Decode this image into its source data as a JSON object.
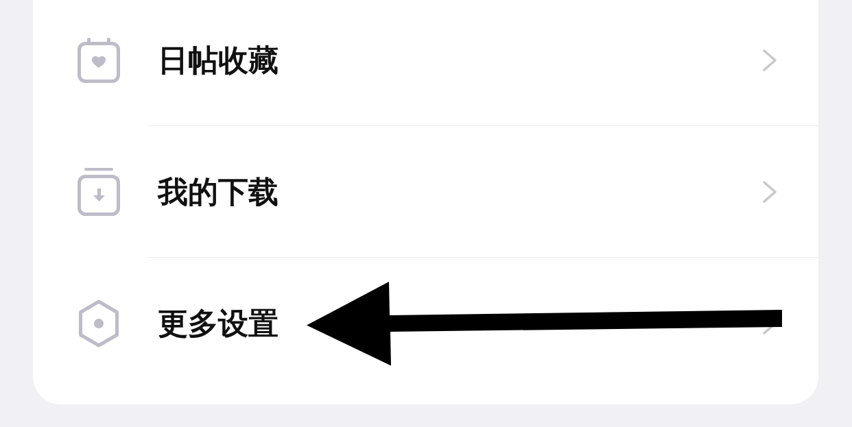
{
  "menu": {
    "items": [
      {
        "label": "日帖收藏",
        "kind": "calendar"
      },
      {
        "label": "我的下载",
        "kind": "download"
      },
      {
        "label": "更多设置",
        "kind": "settings"
      }
    ]
  }
}
